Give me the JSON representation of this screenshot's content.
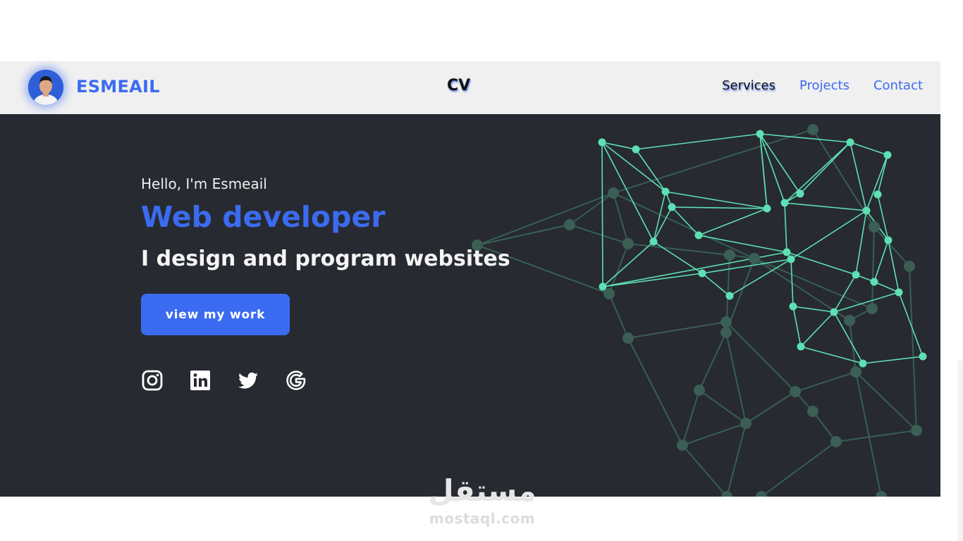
{
  "navbar": {
    "brand": "ESMEAIL",
    "center_title": "CV",
    "links": [
      {
        "label": "Services",
        "active": true
      },
      {
        "label": "Projects",
        "active": false
      },
      {
        "label": "Contact",
        "active": false
      }
    ]
  },
  "hero": {
    "greeting": "Hello, I'm Esmeail",
    "role": "Web developer",
    "tagline": "I design and program websites",
    "cta_label": "view my work",
    "socials": [
      "instagram-icon",
      "linkedin-icon",
      "twitter-icon",
      "google-icon"
    ]
  },
  "watermark": {
    "arabic": "مستقل",
    "url": "mostaql.com"
  },
  "colors": {
    "accent": "#3b6bf0",
    "hero_bg": "#272a31",
    "navbar_bg": "#f0f0f0",
    "network_bright": "#5ee0b4",
    "network_dim": "#3d6b60"
  }
}
